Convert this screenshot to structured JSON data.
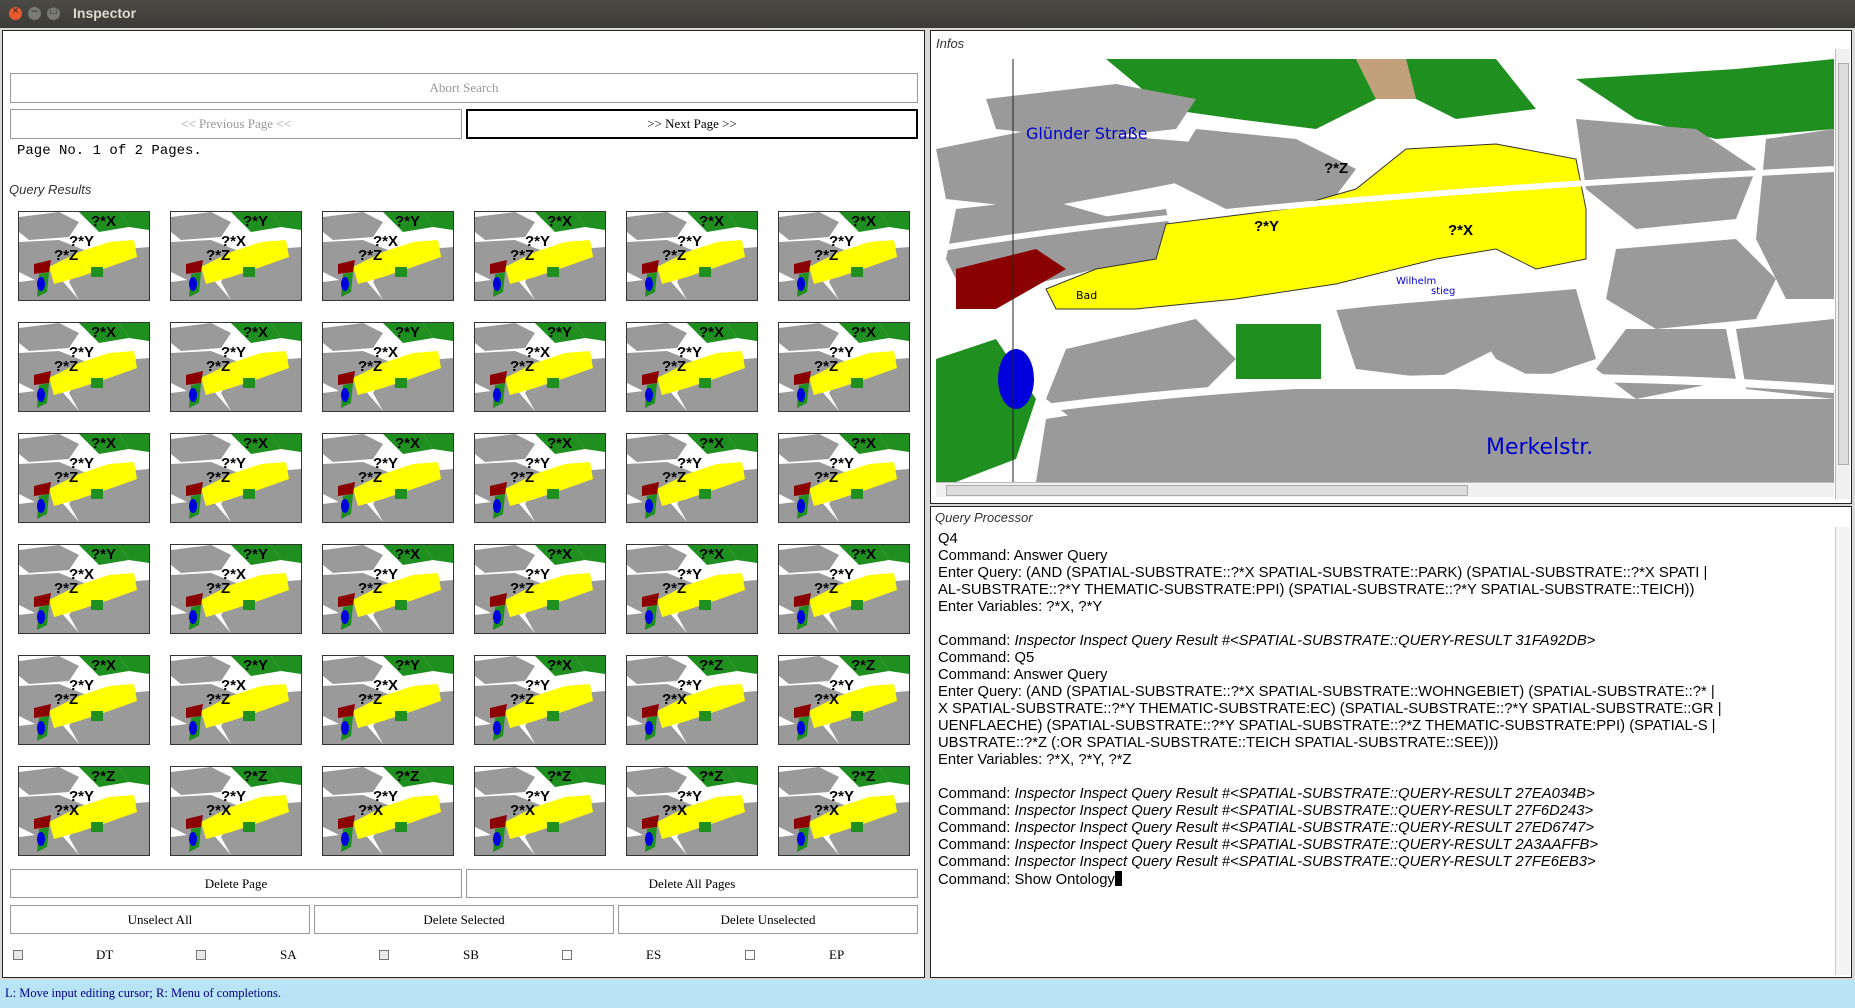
{
  "window": {
    "title": "Inspector"
  },
  "left": {
    "abort_search": "Abort Search",
    "prev_page": "<< Previous Page <<",
    "next_page": ">> Next Page >>",
    "page_info": "Page No. 1 of 2 Pages.",
    "results_label": "Query Results",
    "delete_page": "Delete Page",
    "delete_all_pages": "Delete All Pages",
    "unselect_all": "Unselect All",
    "delete_selected": "Delete Selected",
    "delete_unselected": "Delete Unselected",
    "checkboxes": [
      {
        "label": "DT"
      },
      {
        "label": "SA"
      },
      {
        "label": "SB"
      },
      {
        "label": "ES"
      },
      {
        "label": "EP"
      }
    ]
  },
  "thumbnails": [
    [
      "?*X",
      "?*Y",
      "?*Z"
    ],
    [
      "?*Y",
      "?*X",
      "?*Z"
    ],
    [
      "?*Y",
      "?*X",
      "?*Z"
    ],
    [
      "?*X",
      "?*Y",
      "?*Z"
    ],
    [
      "?*X",
      "?*Y",
      "?*Z"
    ],
    [
      "?*X",
      "?*Y",
      "?*Z"
    ],
    [
      "?*X",
      "?*Y",
      "?*Z"
    ],
    [
      "?*X",
      "?*Y",
      "?*Z"
    ],
    [
      "?*Y",
      "?*X",
      "?*Z"
    ],
    [
      "?*Y",
      "?*X",
      "?*Z"
    ],
    [
      "?*X",
      "?*Y",
      "?*Z"
    ],
    [
      "?*X",
      "?*Y",
      "?*Z"
    ],
    [
      "?*X",
      "?*Y",
      "?*Z"
    ],
    [
      "?*X",
      "?*Y",
      "?*Z"
    ],
    [
      "?*X",
      "?*Y",
      "?*Z"
    ],
    [
      "?*X",
      "?*Y",
      "?*Z"
    ],
    [
      "?*X",
      "?*Y",
      "?*Z"
    ],
    [
      "?*X",
      "?*Y",
      "?*Z"
    ],
    [
      "?*Y",
      "?*X",
      "?*Z"
    ],
    [
      "?*Y",
      "?*X",
      "?*Z"
    ],
    [
      "?*X",
      "?*Y",
      "?*Z"
    ],
    [
      "?*X",
      "?*Y",
      "?*Z"
    ],
    [
      "?*X",
      "?*Y",
      "?*Z"
    ],
    [
      "?*X",
      "?*Y",
      "?*Z"
    ],
    [
      "?*X",
      "?*Y",
      "?*Z"
    ],
    [
      "?*Y",
      "?*X",
      "?*Z"
    ],
    [
      "?*Y",
      "?*X",
      "?*Z"
    ],
    [
      "?*X",
      "?*Y",
      "?*Z"
    ],
    [
      "?*Z",
      "?*Y",
      "?*X"
    ],
    [
      "?*Z",
      "?*Y",
      "?*X"
    ],
    [
      "?*Z",
      "?*Y",
      "?*X"
    ],
    [
      "?*Z",
      "?*Y",
      "?*X"
    ],
    [
      "?*Z",
      "?*Y",
      "?*X"
    ],
    [
      "?*Z",
      "?*Y",
      "?*X"
    ],
    [
      "?*Z",
      "?*Y",
      "?*X"
    ],
    [
      "?*Z",
      "?*Y",
      "?*X"
    ]
  ],
  "infos": {
    "label": "Infos",
    "map": {
      "markers": [
        "?*Z",
        "?*Y",
        "?*X"
      ],
      "street_labels": [
        "Glünder Straße",
        "Merkelstr.",
        "Bad",
        "Wilhelm",
        "stieg"
      ]
    }
  },
  "query_processor": {
    "label": "Query Processor",
    "lines": [
      {
        "text": "Q4"
      },
      {
        "text": "Command: Answer Query"
      },
      {
        "text": "Enter Query: (AND (SPATIAL-SUBSTRATE::?*X SPATIAL-SUBSTRATE::PARK) (SPATIAL-SUBSTRATE::?*X SPATI |"
      },
      {
        "text": "AL-SUBSTRATE::?*Y THEMATIC-SUBSTRATE:PPI) (SPATIAL-SUBSTRATE::?*Y SPATIAL-SUBSTRATE::TEICH))"
      },
      {
        "text": "Enter Variables: ?*X, ?*Y"
      },
      {
        "text": ""
      },
      {
        "prefix": "Command: ",
        "text": "Inspector Inspect Query Result #<SPATIAL-SUBSTRATE::QUERY-RESULT 31FA92DB>"
      },
      {
        "text": "Command: Q5"
      },
      {
        "text": "Command: Answer Query"
      },
      {
        "text": "Enter Query: (AND (SPATIAL-SUBSTRATE::?*X SPATIAL-SUBSTRATE::WOHNGEBIET) (SPATIAL-SUBSTRATE::?* |"
      },
      {
        "text": "X SPATIAL-SUBSTRATE::?*Y THEMATIC-SUBSTRATE:EC) (SPATIAL-SUBSTRATE::?*Y SPATIAL-SUBSTRATE::GR |"
      },
      {
        "text": "UENFLAECHE) (SPATIAL-SUBSTRATE::?*Y SPATIAL-SUBSTRATE::?*Z THEMATIC-SUBSTRATE:PPI) (SPATIAL-S |"
      },
      {
        "text": "UBSTRATE::?*Z (:OR SPATIAL-SUBSTRATE::TEICH SPATIAL-SUBSTRATE::SEE)))"
      },
      {
        "text": "Enter Variables: ?*X, ?*Y, ?*Z"
      },
      {
        "text": ""
      },
      {
        "prefix": "Command: ",
        "text": "Inspector Inspect Query Result #<SPATIAL-SUBSTRATE::QUERY-RESULT 27EA034B>"
      },
      {
        "prefix": "Command: ",
        "text": "Inspector Inspect Query Result #<SPATIAL-SUBSTRATE::QUERY-RESULT 27F6D243>"
      },
      {
        "prefix": "Command: ",
        "text": "Inspector Inspect Query Result #<SPATIAL-SUBSTRATE::QUERY-RESULT 27ED6747>"
      },
      {
        "prefix": "Command: ",
        "text": "Inspector Inspect Query Result #<SPATIAL-SUBSTRATE::QUERY-RESULT 2A3AAFFB>"
      },
      {
        "prefix": "Command: ",
        "text": "Inspector Inspect Query Result #<SPATIAL-SUBSTRATE::QUERY-RESULT 27FE6EB3>"
      },
      {
        "text": "Command: Show Ontology"
      }
    ]
  },
  "status": {
    "text": "L: Move input editing cursor; R: Menu of completions."
  },
  "colors": {
    "yellow": "#ffff00",
    "park_green": "#1a9a1a",
    "building_red": "#8b0000",
    "street_gray": "#9a9a9a",
    "water_blue": "#0000dd"
  }
}
